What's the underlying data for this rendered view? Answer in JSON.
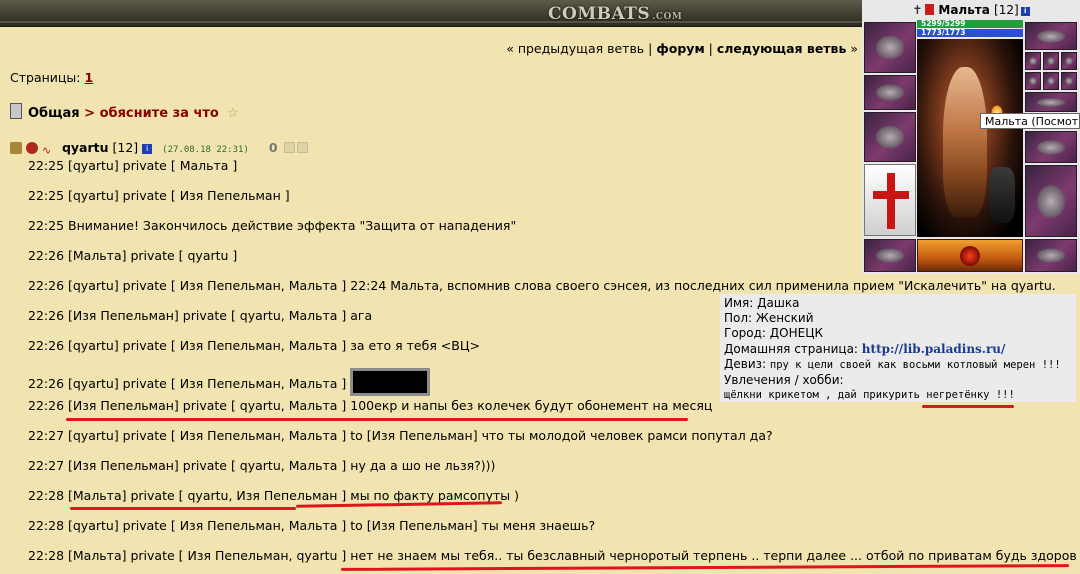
{
  "banner": {
    "logo": "COMBATS",
    "logo_suffix": ".COM"
  },
  "nav": {
    "prev": "« предыдущая ветвь",
    "sep1": " | ",
    "forum": "форум",
    "sep2": " | ",
    "next": "следующая ветвь",
    "tail": " »"
  },
  "pages": {
    "label": "Страницы:",
    "current": "1"
  },
  "topic": {
    "forum": "Общая",
    "arrow": " > ",
    "title": "обясните за что",
    "star": "☆"
  },
  "post": {
    "user": "qyartu",
    "level": "[12]",
    "date": "(27.08.18 22:31)",
    "score": "0"
  },
  "chat": [
    "22:25 [qyartu] private [ Мальта ]",
    "22:25 [qyartu] private [ Изя Пепельман ]",
    "22:25 Внимание! Закончилось действие эффекта \"Защита от нападения\"",
    "22:26 [Мальта] private [ qyartu ]",
    "22:26 [qyartu] private [ Изя Пепельман, Мальта ] 22:24 Мальта, вспомнив слова своего сэнсея, из последних сил применила прием \"Искалечить\" на qyartu.",
    "22:26 [Изя Пепельман] private [ qyartu, Мальта ] ага",
    "22:26 [qyartu] private [ Изя Пепельман, Мальта ] за ето я тебя <ВЦ>",
    "22:26 [qyartu] private [ Изя Пепельман, Мальта ]",
    "22:26 [Изя Пепельман] private [ qyartu, Мальта ] 100екр и напы без колечек будут обонемент на месяц",
    "22:27 [qyartu] private [ Изя Пепельман, Мальта ] to [Изя Пепельман] что ты молодой человек рамси попутал да?",
    "22:27 [Изя Пепельман] private [ qyartu, Мальта ] ну да а шо не льзя?)))",
    "22:28 [Мальта] private [ qyartu, Изя Пепельман ] мы по факту рамсопуты )",
    "22:28 [qyartu] private [ Изя Пепельман, Мальта ] to [Изя Пепельман] ты меня знаешь?",
    "22:28 [Мальта] private [ Изя Пепельман, qyartu ] нет не знаем мы тебя.. ты безславный черноротый терпень .. терпи далее ... отбой по приватам будь здоров чудак"
  ],
  "character": {
    "name": "Мальта",
    "level": "[12]",
    "hp": "5299/5299",
    "mp": "1773/1773",
    "tooltip": "Мальта (Посмотр"
  },
  "profile": {
    "name": "Имя: Дашка",
    "gender": "Пол: Женский",
    "city": "Город: ДОНЕЦК",
    "homepage_label": "Домашняя страница: ",
    "homepage_url": "http://lib.paladins.ru/",
    "motto_label": "Девиз: ",
    "motto": "пру к цели своей как восьми котловый мерен !!!",
    "hobbies_label": "Увлечения / хобби:",
    "hobbies": "щёлкни крикетом , дай прикурить негретёнку !!!"
  },
  "colors": {
    "background": "#f2e4b0",
    "link_red": "#8a0000",
    "underline": "#e0141a"
  }
}
